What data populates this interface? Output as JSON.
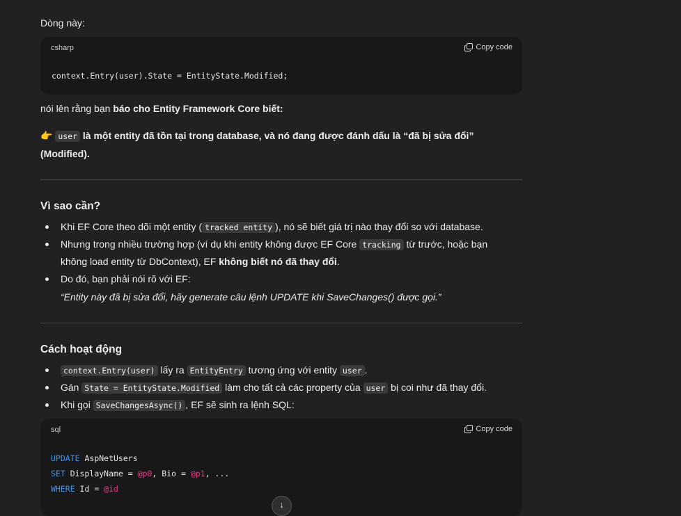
{
  "intro": {
    "label": "Dòng này:"
  },
  "code1": {
    "lang": "csharp",
    "copy_label": "Copy code",
    "line": "context.Entry(user).State = EntityState.Modified;"
  },
  "para1": {
    "pre": "nói lên rằng bạn ",
    "bold": "báo cho Entity Framework Core biết:"
  },
  "para2": {
    "emoji": "👉",
    "code": "user",
    "line1": " là một entity đã tồn tại trong database, và nó đang được đánh dấu là “đã bị sửa đổi”",
    "line2": "(Modified)."
  },
  "section1": {
    "title": "Vì sao cần?",
    "b1": {
      "pre": "Khi EF Core theo dõi một entity (",
      "code": "tracked entity",
      "post": "), nó sẽ biết giá trị nào thay đổi so với database."
    },
    "b2": {
      "pre": "Nhưng trong nhiều trường hợp (ví dụ khi entity không được EF Core ",
      "code": "tracking",
      "post": " từ trước, hoặc bạn"
    },
    "b2b": {
      "pre": "không load entity từ DbContext), EF ",
      "bold": "không biết nó đã thay đổi",
      "post": "."
    },
    "b3": "Do đó, bạn phải nói rõ với EF:",
    "b3q": "“Entity này đã bị sửa đổi, hãy generate câu lệnh UPDATE khi SaveChanges() được gọi.”"
  },
  "section2": {
    "title": "Cách hoạt động",
    "b1": {
      "code1": "context.Entry(user)",
      "mid": " lấy ra ",
      "code2": "EntityEntry",
      "mid2": " tương ứng với entity ",
      "code3": "user",
      "post": "."
    },
    "b2": {
      "pre": "Gán ",
      "code1": "State = EntityState.Modified",
      "mid": " làm cho tất cả các property của ",
      "code2": "user",
      "post": " bị coi như đã thay đổi."
    },
    "b3": {
      "pre": "Khi gọi ",
      "code": "SaveChangesAsync()",
      "post": ", EF sẽ sinh ra lệnh SQL:"
    }
  },
  "code2": {
    "lang": "sql",
    "copy_label": "Copy code",
    "l1_kw": "UPDATE",
    "l1_rest": " AspNetUsers",
    "l2_kw": "SET",
    "l2_a": " DisplayName = ",
    "l2_v1": "@p0",
    "l2_b": ", Bio = ",
    "l2_v2": "@p1",
    "l2_c": ", ...",
    "l3_kw": "WHERE",
    "l3_a": " Id = ",
    "l3_v": "@id"
  },
  "scroll": {
    "icon": "↓"
  }
}
